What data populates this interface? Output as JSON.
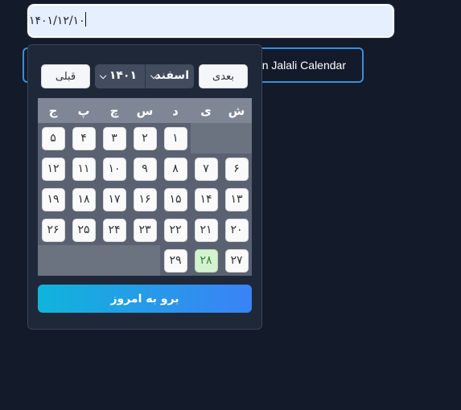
{
  "input": {
    "value": "۱۴۰۱/۱۲/۱۰"
  },
  "background_button": {
    "label": "n Jalali Calendar"
  },
  "popup": {
    "prev_label": "قبلی",
    "next_label": "بعدی",
    "year_value": "۱۴۰۱",
    "month_value": "اسفند",
    "weekdays": [
      "ش",
      "ی",
      "د",
      "س",
      "چ",
      "پ",
      "ج"
    ],
    "weeks": [
      [
        "",
        "",
        "۱",
        "۲",
        "۳",
        "۴",
        "۵"
      ],
      [
        "۶",
        "۷",
        "۸",
        "۹",
        "۱۰",
        "۱۱",
        "۱۲"
      ],
      [
        "۱۳",
        "۱۴",
        "۱۵",
        "۱۶",
        "۱۷",
        "۱۸",
        "۱۹"
      ],
      [
        "۲۰",
        "۲۱",
        "۲۲",
        "۲۳",
        "۲۴",
        "۲۵",
        "۲۶"
      ],
      [
        "۲۷",
        "۲۸",
        "۲۹",
        "",
        "",
        "",
        ""
      ]
    ],
    "today_day": "۲۸",
    "go_today_label": "برو به امروز"
  },
  "colors": {
    "accent_start": "#10b4db",
    "accent_end": "#3b82f6",
    "today_bg": "#d4f2d0"
  }
}
